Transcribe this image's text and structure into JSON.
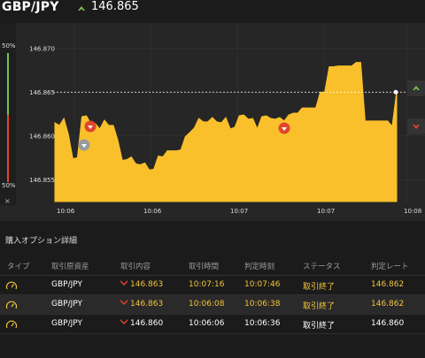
{
  "header": {
    "pair": "GBP/JPY",
    "price": "146.865"
  },
  "gauge": {
    "top_pct": "50%",
    "bottom_pct": "50%",
    "close_label": "×"
  },
  "chart_data": {
    "type": "area",
    "y_ticks": [
      "146.870",
      "146.865",
      "146.860",
      "146.855"
    ],
    "x_ticks": [
      "10:06",
      "10:06",
      "10:07",
      "10:07",
      "10:08"
    ],
    "current_level_label": "146.865",
    "series": [
      {
        "values": [
          146.8615,
          146.8612,
          146.862,
          146.8602,
          146.8574,
          146.8575,
          146.8622,
          146.8623,
          146.8614,
          146.8614,
          146.8608,
          146.8618,
          146.8612,
          146.8612,
          146.8595,
          146.8572,
          146.8573,
          146.8576,
          146.8568,
          146.8567,
          146.8569,
          146.8561,
          146.8562,
          146.8577,
          146.8576,
          146.8583,
          146.8583,
          146.8583,
          146.8584,
          146.8599,
          146.8604,
          146.8609,
          146.862,
          146.8616,
          146.8616,
          146.8621,
          146.8616,
          146.8615,
          146.8621,
          146.8608,
          146.861,
          146.8623,
          146.8624,
          146.8619,
          146.862,
          146.8608,
          146.8622,
          146.8623,
          146.862,
          146.8619,
          146.8621,
          146.8617,
          146.8624,
          146.8626,
          146.8626,
          146.8632,
          146.8632,
          146.8632,
          146.8632,
          146.865,
          146.865,
          146.8679,
          146.8679,
          146.868,
          146.868,
          146.868,
          146.868,
          146.8684,
          146.8684,
          146.8617,
          146.8617,
          146.8617,
          146.8617,
          146.8617,
          146.8617,
          146.8611,
          146.8651
        ]
      }
    ]
  },
  "table": {
    "title": "購入オプション詳細",
    "headers": [
      "タイプ",
      "取引原資産",
      "取引内容",
      "取引時間",
      "判定時刻",
      "ステータス",
      "判定レート"
    ],
    "rows": [
      [
        "GBP/JPY",
        "146.863",
        "10:07:16",
        "10:07:46",
        "取引終了",
        "146.862"
      ],
      [
        "GBP/JPY",
        "146.863",
        "10:06:08",
        "10:06:38",
        "取引終了",
        "146.862"
      ],
      [
        "GBP/JPY",
        "146.860",
        "10:06:06",
        "10:06:36",
        "取引終了",
        "146.860"
      ]
    ]
  },
  "colors": {
    "area": "#f9c02b",
    "up": "#7cc04b",
    "down": "#e0452c",
    "level": "#ffffff"
  }
}
